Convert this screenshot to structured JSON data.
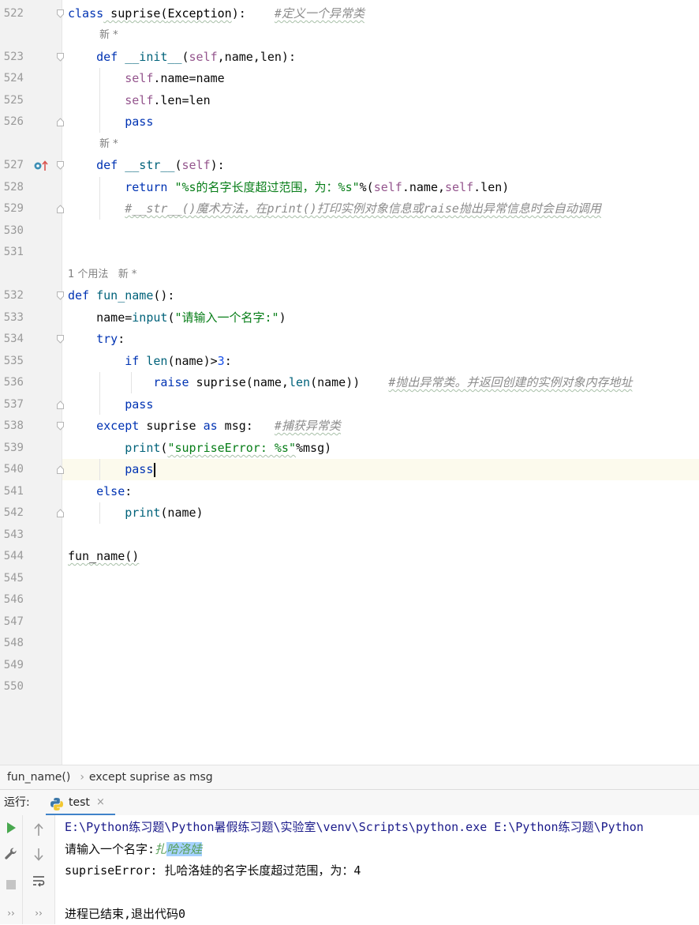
{
  "editor": {
    "line_numbers": [
      "522",
      "523",
      "524",
      "525",
      "526",
      "527",
      "528",
      "529",
      "530",
      "531",
      "532",
      "533",
      "534",
      "535",
      "536",
      "537",
      "538",
      "539",
      "540",
      "541",
      "542",
      "543",
      "544",
      "545",
      "546",
      "547",
      "548",
      "549",
      "550"
    ],
    "hints": {
      "new_1": "新 *",
      "new_2": "新 *",
      "usage": "1 个用法   新 *"
    },
    "code": {
      "l522_kw": "class",
      "l522_name": " suprise(",
      "l522_base": "Exception",
      "l522_end": "):",
      "l522_cmt": "#定义一个异常类",
      "l523_def": "def",
      "l523_fn": "__init__",
      "l523_p1": "(",
      "l523_self": "self",
      "l523_p2": ",name,len):",
      "l524_self": "self",
      "l524_rest": ".name=name",
      "l525_self": "self",
      "l525_rest": ".len=len",
      "l526_pass": "pass",
      "l527_def": "def",
      "l527_fn": "__str__",
      "l527_p1": "(",
      "l527_self": "self",
      "l527_p2": "):",
      "l528_ret": "return",
      "l528_str": "\"%s的名字长度超过范围，为：%s\"",
      "l528_op": "%(",
      "l528_self1": "self",
      "l528_mid": ".name,",
      "l528_self2": "self",
      "l528_end": ".len)",
      "l529_cmt": "#__str__()魔术方法，在print()打印实例对象信息或raise抛出异常信息时会自动调用",
      "l532_def": "def",
      "l532_fn": "fun_name",
      "l532_end": "():",
      "l533_a": "name=",
      "l533_fn": "input",
      "l533_p": "(",
      "l533_str": "\"请输入一个名字:\"",
      "l533_e": ")",
      "l534_try": "try",
      "l534_colon": ":",
      "l535_if": "if",
      "l535_fn": "len",
      "l535_mid": "(name)>",
      "l535_num": "3",
      "l535_colon": ":",
      "l536_raise": "raise",
      "l536_a": " suprise(name,",
      "l536_fn": "len",
      "l536_b": "(name))",
      "l536_cmt": "#抛出异常类。并返回创建的实例对象内存地址",
      "l537_pass": "pass",
      "l538_except": "except",
      "l538_a": " suprise ",
      "l538_as": "as",
      "l538_b": " msg:",
      "l538_cmt": "#捕获异常类",
      "l539_fn": "print",
      "l539_p": "(",
      "l539_str": "\"supriseError: %s\"",
      "l539_e": "%msg)",
      "l540_pass": "pass",
      "l541_else": "else",
      "l541_colon": ":",
      "l542_fn": "print",
      "l542_e": "(name)",
      "l544_call": "fun_name()"
    }
  },
  "breadcrumb": {
    "item1": "fun_name()",
    "separator": "›",
    "item2": "except suprise as msg"
  },
  "run_panel": {
    "label": "运行:",
    "tab_name": "test",
    "tab_close": "×",
    "console": {
      "cmd": "E:\\Python练习题\\Python暑假练习题\\实验室\\venv\\Scripts\\python.exe E:\\Python练习题\\Python",
      "prompt": "请输入一个名字:",
      "input_first": "扎",
      "input_selected": "哈洛娃",
      "error_line": "supriseError: 扎哈洛娃的名字长度超过范围，为：4",
      "exit_line": "进程已结束,退出代码0"
    },
    "icons": [
      "run-icon",
      "wrench-icon",
      "stop-icon",
      "up-arrow-icon",
      "down-arrow-icon",
      "soft-wrap-icon",
      "more-icon"
    ]
  },
  "colors": {
    "keyword": "#0033b3",
    "self": "#94558d",
    "function": "#00627a",
    "string": "#067d17",
    "comment": "#8c8c8c",
    "number": "#1750eb",
    "current_line": "#fcfaed",
    "tab_underline": "#4083c9"
  }
}
